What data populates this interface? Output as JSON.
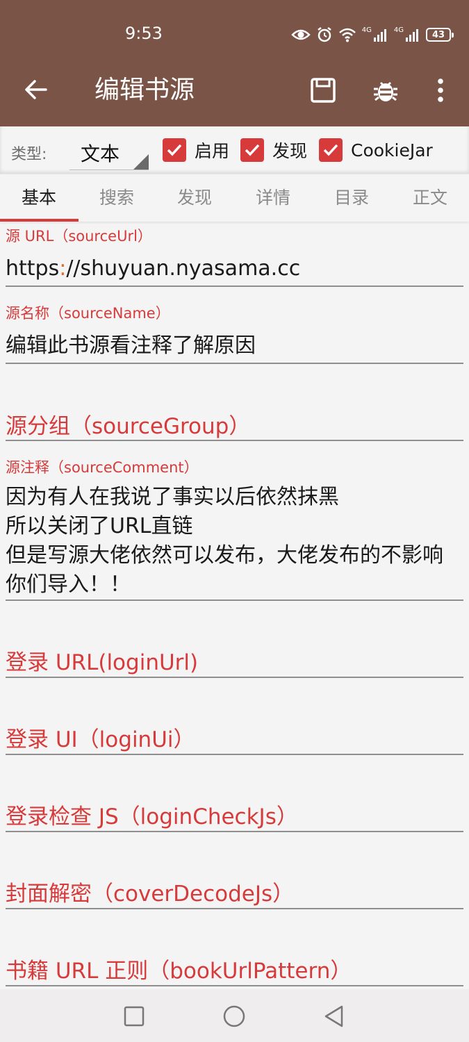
{
  "status_bar": {
    "time": "9:53",
    "net1": "4G",
    "net2": "4G",
    "battery": "43"
  },
  "toolbar": {
    "title": "编辑书源",
    "icons": [
      "back-arrow-icon",
      "save-icon",
      "bug-icon",
      "more-vert-icon"
    ]
  },
  "type_row": {
    "label": "类型:",
    "selected": "文本",
    "checkboxes": [
      {
        "label": "启用",
        "checked": true
      },
      {
        "label": "发现",
        "checked": true
      },
      {
        "label": "CookieJar",
        "checked": true
      }
    ]
  },
  "tabs": [
    "基本",
    "搜索",
    "发现",
    "详情",
    "目录",
    "正文"
  ],
  "active_tab": "基本",
  "fields": {
    "source_url": {
      "label": "源 URL（sourceUrl）",
      "value_a": "https",
      "value_colon": ":",
      "value_b": "//shuyuan.nyasama.cc"
    },
    "source_name": {
      "label": "源名称（sourceName）",
      "value": "编辑此书源看注释了解原因"
    },
    "source_group": {
      "label": "源分组（sourceGroup）"
    },
    "source_comment": {
      "label": "源注释（sourceComment）",
      "value": "因为有人在我说了事实以后依然抹黑\n所以关闭了URL直链\n但是写源大佬依然可以发布，大佬发布的不影响你们导入！！"
    },
    "login_url": {
      "label": "登录 URL(loginUrl)"
    },
    "login_ui": {
      "label": "登录 UI（loginUi）"
    },
    "login_check_js": {
      "label": "登录检查 JS（loginCheckJs）"
    },
    "cover_decode_js": {
      "label": "封面解密（coverDecodeJs）"
    },
    "book_url_pattern": {
      "label": "书籍 URL 正则（bookUrlPattern）"
    }
  },
  "colors": {
    "toolbar": "#7a5446",
    "accent": "#d63a3a",
    "background": "#f5f4f4"
  }
}
